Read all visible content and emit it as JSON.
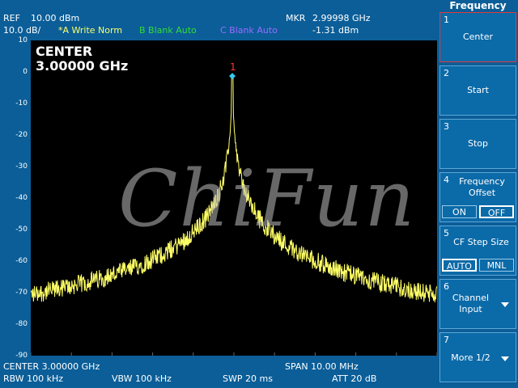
{
  "header": {
    "ref_label": "REF",
    "ref_value": "10.00 dBm",
    "scale": "10.0 dB/",
    "trace_a": "*A Write Norm",
    "trace_b": "B Blank Auto",
    "trace_c": "C Blank Auto",
    "marker_label": "MKR",
    "marker_freq": "2.99998 GHz",
    "marker_level": "-1.31 dBm"
  },
  "colors": {
    "trace_a": "#ffff66",
    "trace_b": "#33dd33",
    "trace_c": "#9a6cff",
    "marker": "#ff3333"
  },
  "display": {
    "center_title": "CENTER",
    "center_value": "3.00000 GHz",
    "marker_number": "1",
    "watermark": "ChiFun",
    "y_ticks": [
      "10",
      "0",
      "-10",
      "-20",
      "-30",
      "-40",
      "-50",
      "-60",
      "-70",
      "-80",
      "-90"
    ]
  },
  "footer": {
    "center": "CENTER 3.00000 GHz",
    "span": "SPAN 10.00 MHz",
    "rbw": "RBW 100 kHz",
    "vbw": "VBW 100 kHz",
    "swp": "SWP 20 ms",
    "att": "ATT 20 dB"
  },
  "softkeys": {
    "title": "Frequency",
    "k1": {
      "num": "1",
      "label": "Center"
    },
    "k2": {
      "num": "2",
      "label": "Start"
    },
    "k3": {
      "num": "3",
      "label": "Stop"
    },
    "k4": {
      "num": "4",
      "label": "Frequency\nOffset",
      "opt_on": "ON",
      "opt_off": "OFF"
    },
    "k5": {
      "num": "5",
      "label": "CF Step Size",
      "opt_auto": "AUTO",
      "opt_mnl": "MNL"
    },
    "k6": {
      "num": "6",
      "label": "Channel\nInput"
    },
    "k7": {
      "num": "7",
      "label": "More 1/2"
    }
  },
  "chart_data": {
    "type": "line",
    "ylim": [
      -90,
      10
    ],
    "y_unit": "dBm",
    "x_center_ghz": 3.0,
    "x_span_mhz": 10.0,
    "peak": {
      "x_ghz": 2.99998,
      "y_dbm": -1.31
    },
    "noise_floor_dbm": -75
  }
}
